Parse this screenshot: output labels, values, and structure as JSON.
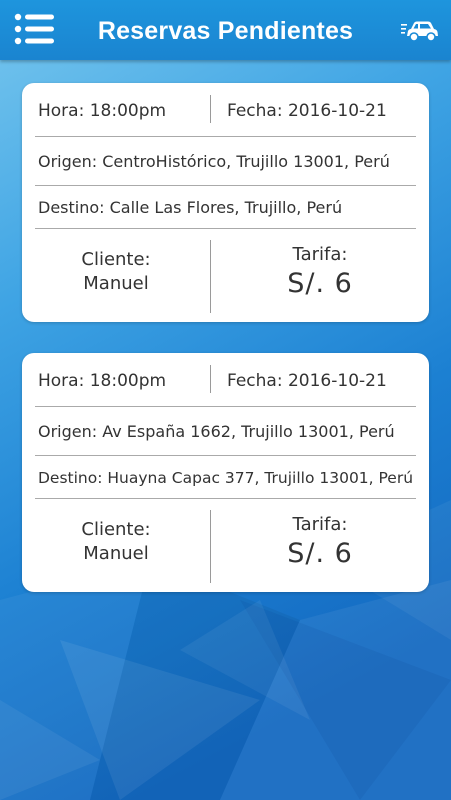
{
  "header": {
    "title": "Reservas Pendientes",
    "menu_icon": "hamburger-list-icon",
    "car_icon": "car-icon"
  },
  "colors": {
    "header": "#1a8ad6",
    "card": "#ffffff",
    "text": "#333333",
    "background": "#1d8bd8"
  },
  "reservas": [
    {
      "hora": "Hora: 18:00pm",
      "fecha": "Fecha: 2016-10-21",
      "origen": "Origen: CentroHistórico, Trujillo 13001, Perú",
      "destino": "Destino: Calle Las Flores, Trujillo, Perú",
      "cliente_label": "Cliente:",
      "cliente_nombre": "Manuel",
      "tarifa_label": "Tarifa:",
      "tarifa_valor": "S/. 6"
    },
    {
      "hora": "Hora: 18:00pm",
      "fecha": "Fecha: 2016-10-21",
      "origen": "Origen: Av España 1662, Trujillo 13001, Perú",
      "destino": "Destino: Huayna Capac 377, Trujillo 13001, Perú",
      "cliente_label": "Cliente:",
      "cliente_nombre": "Manuel",
      "tarifa_label": "Tarifa:",
      "tarifa_valor": "S/. 6"
    }
  ]
}
